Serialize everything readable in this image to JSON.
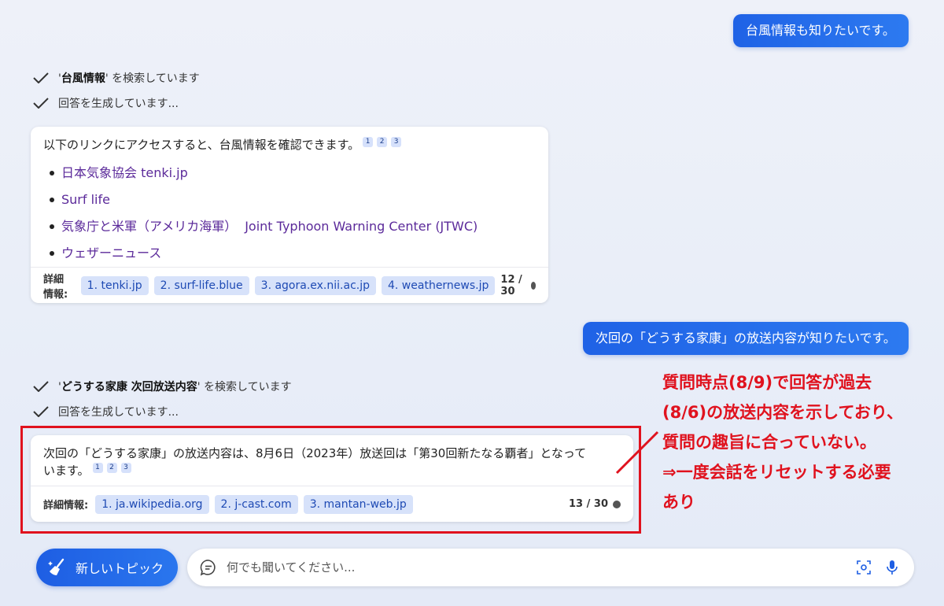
{
  "conversation": {
    "first_question": "台風情報も知りたいです。",
    "first_status": [
      {
        "prefix": "'",
        "term": "台風情報",
        "suffix": "' を検索しています"
      },
      {
        "prefix": "",
        "term": "",
        "suffix": "回答を生成しています..."
      }
    ],
    "first_answer": {
      "text": "以下のリンクにアクセスすると、台風情報を確認できます。",
      "citations": [
        "1",
        "2",
        "3"
      ],
      "links": [
        {
          "label": "日本気象協会 tenki.jp"
        },
        {
          "label": "Surf life"
        },
        {
          "label": "気象庁と米軍（アメリカ海軍）",
          "label2": "Joint Typhoon Warning Center (JTWC)"
        },
        {
          "label": "ウェザーニュース"
        }
      ],
      "more_label": "詳細情報:",
      "sources": [
        "1. tenki.jp",
        "2. surf-life.blue",
        "3. agora.ex.nii.ac.jp",
        "4. weathernews.jp"
      ],
      "counter": "12 / 30"
    },
    "second_question": "次回の「どうする家康」の放送内容が知りたいです。",
    "second_status": [
      {
        "prefix": "'",
        "term": "どうする家康 次回放送内容",
        "suffix": "' を検索しています"
      },
      {
        "prefix": "",
        "term": "",
        "suffix": "回答を生成しています..."
      }
    ],
    "second_answer": {
      "line1": "次回の「どうする家康」の放送内容は、8月6日（2023年）放送回は「第30回新たなる覇者」となって",
      "line2": "います。",
      "citations": [
        "1",
        "2",
        "3"
      ],
      "more_label": "詳細情報:",
      "sources": [
        "1. ja.wikipedia.org",
        "2. j-cast.com",
        "3. mantan-web.jp"
      ],
      "counter": "13 / 30"
    }
  },
  "annotation": {
    "lines": [
      "質問時点(8/9)で回答が過去",
      "(8/6)の放送内容を示しており、",
      "質問の趣旨に合っていない。",
      "⇒一度会話をリセットする必要",
      "あり"
    ],
    "color": "#e0121e"
  },
  "composer": {
    "new_topic_label": "新しいトピック",
    "placeholder": "何でも聞いてください..."
  },
  "colors": {
    "accent": "#1f62e6",
    "link": "#5b2a9a",
    "chip_bg": "#d7e2fa"
  }
}
